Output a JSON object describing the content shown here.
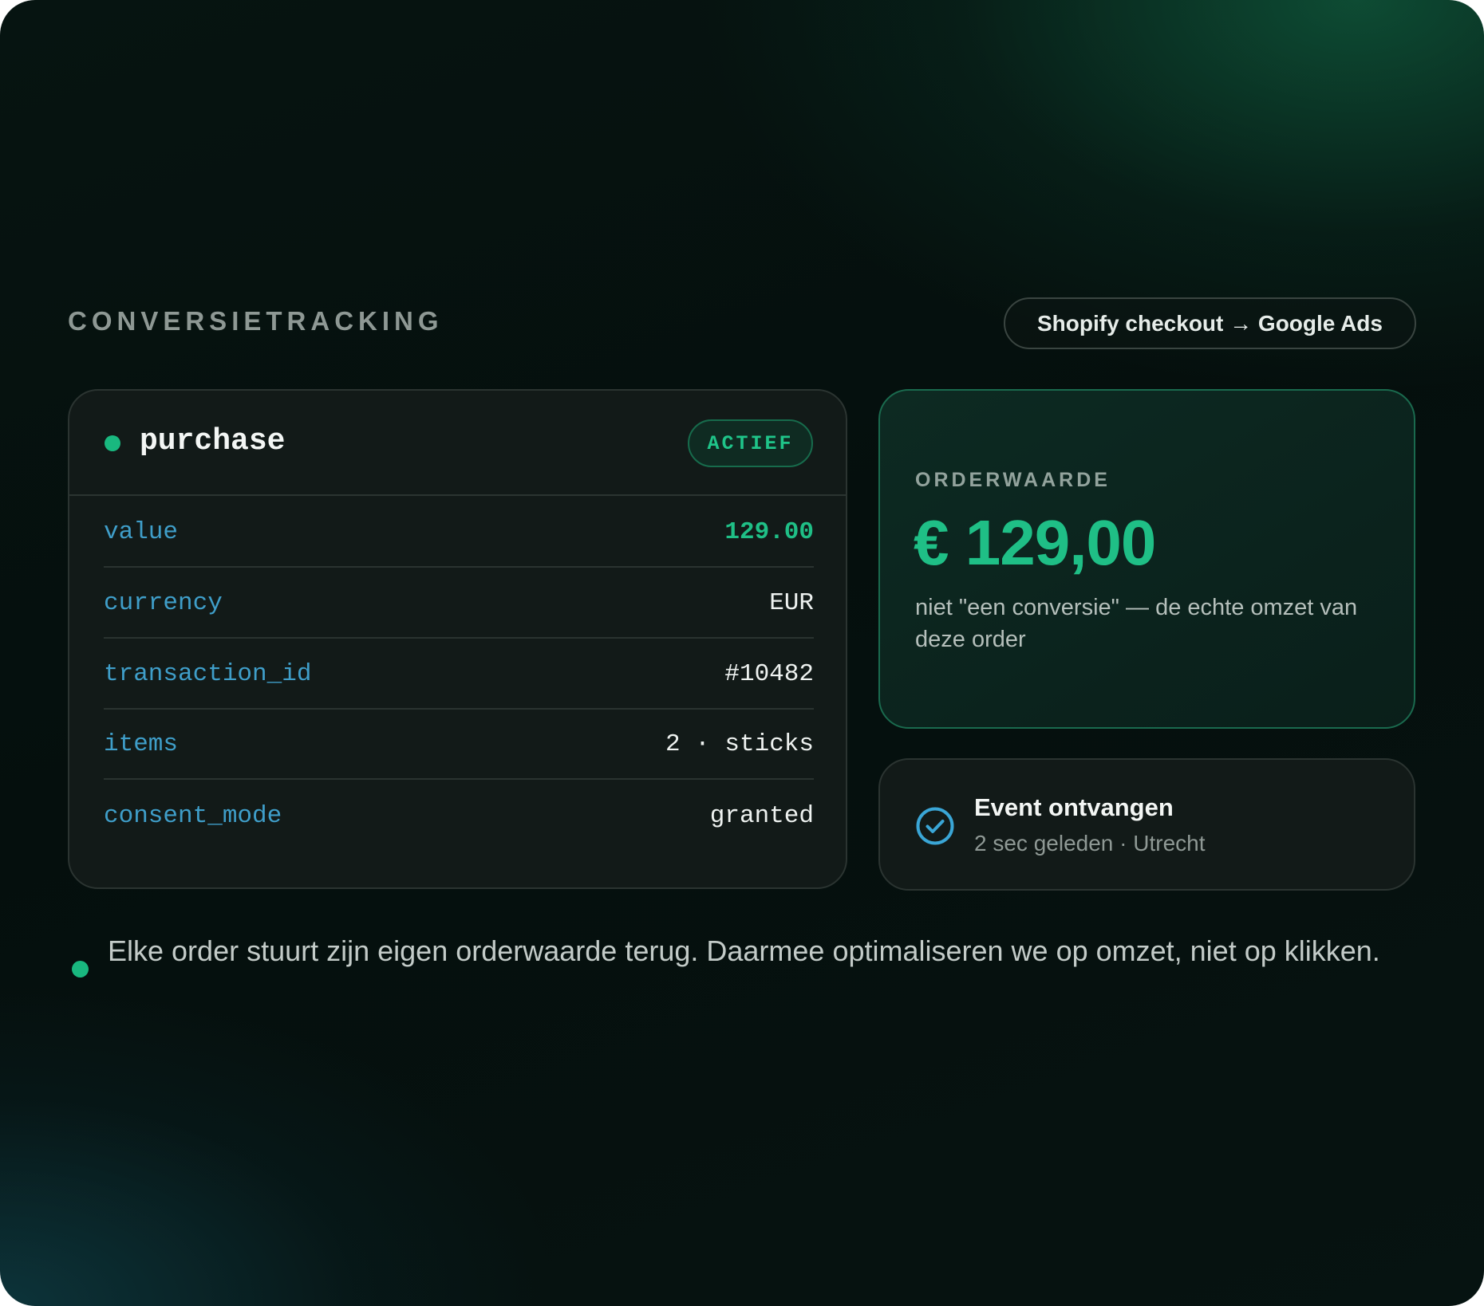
{
  "header": {
    "section_title": "CONVERSIETRACKING",
    "route_label": "Shopify checkout → Google Ads"
  },
  "event": {
    "name": "purchase",
    "status": "ACTIEF",
    "params": [
      {
        "key": "value",
        "value": "129.00"
      },
      {
        "key": "currency",
        "value": "EUR"
      },
      {
        "key": "transaction_id",
        "value": "#10482"
      },
      {
        "key": "items",
        "value": "2 · sticks"
      },
      {
        "key": "consent_mode",
        "value": "granted"
      }
    ]
  },
  "order_value": {
    "label": "ORDERWAARDE",
    "amount": "€ 129,00",
    "note": "niet \"een conversie\" — de echte omzet van deze order"
  },
  "received": {
    "title": "Event ontvangen",
    "meta": "2 sec geleden · Utrecht"
  },
  "footer": {
    "text": "Elke order stuurt zijn eigen orderwaarde terug. Daarmee optimaliseren we op omzet, niet op klikken."
  },
  "colors": {
    "accent_green": "#1fbf86",
    "param_key_blue": "#3f9ec9",
    "check_blue": "#3aa6d6"
  },
  "icons": {
    "status_dot": "green-dot",
    "received": "check-circle-icon"
  }
}
